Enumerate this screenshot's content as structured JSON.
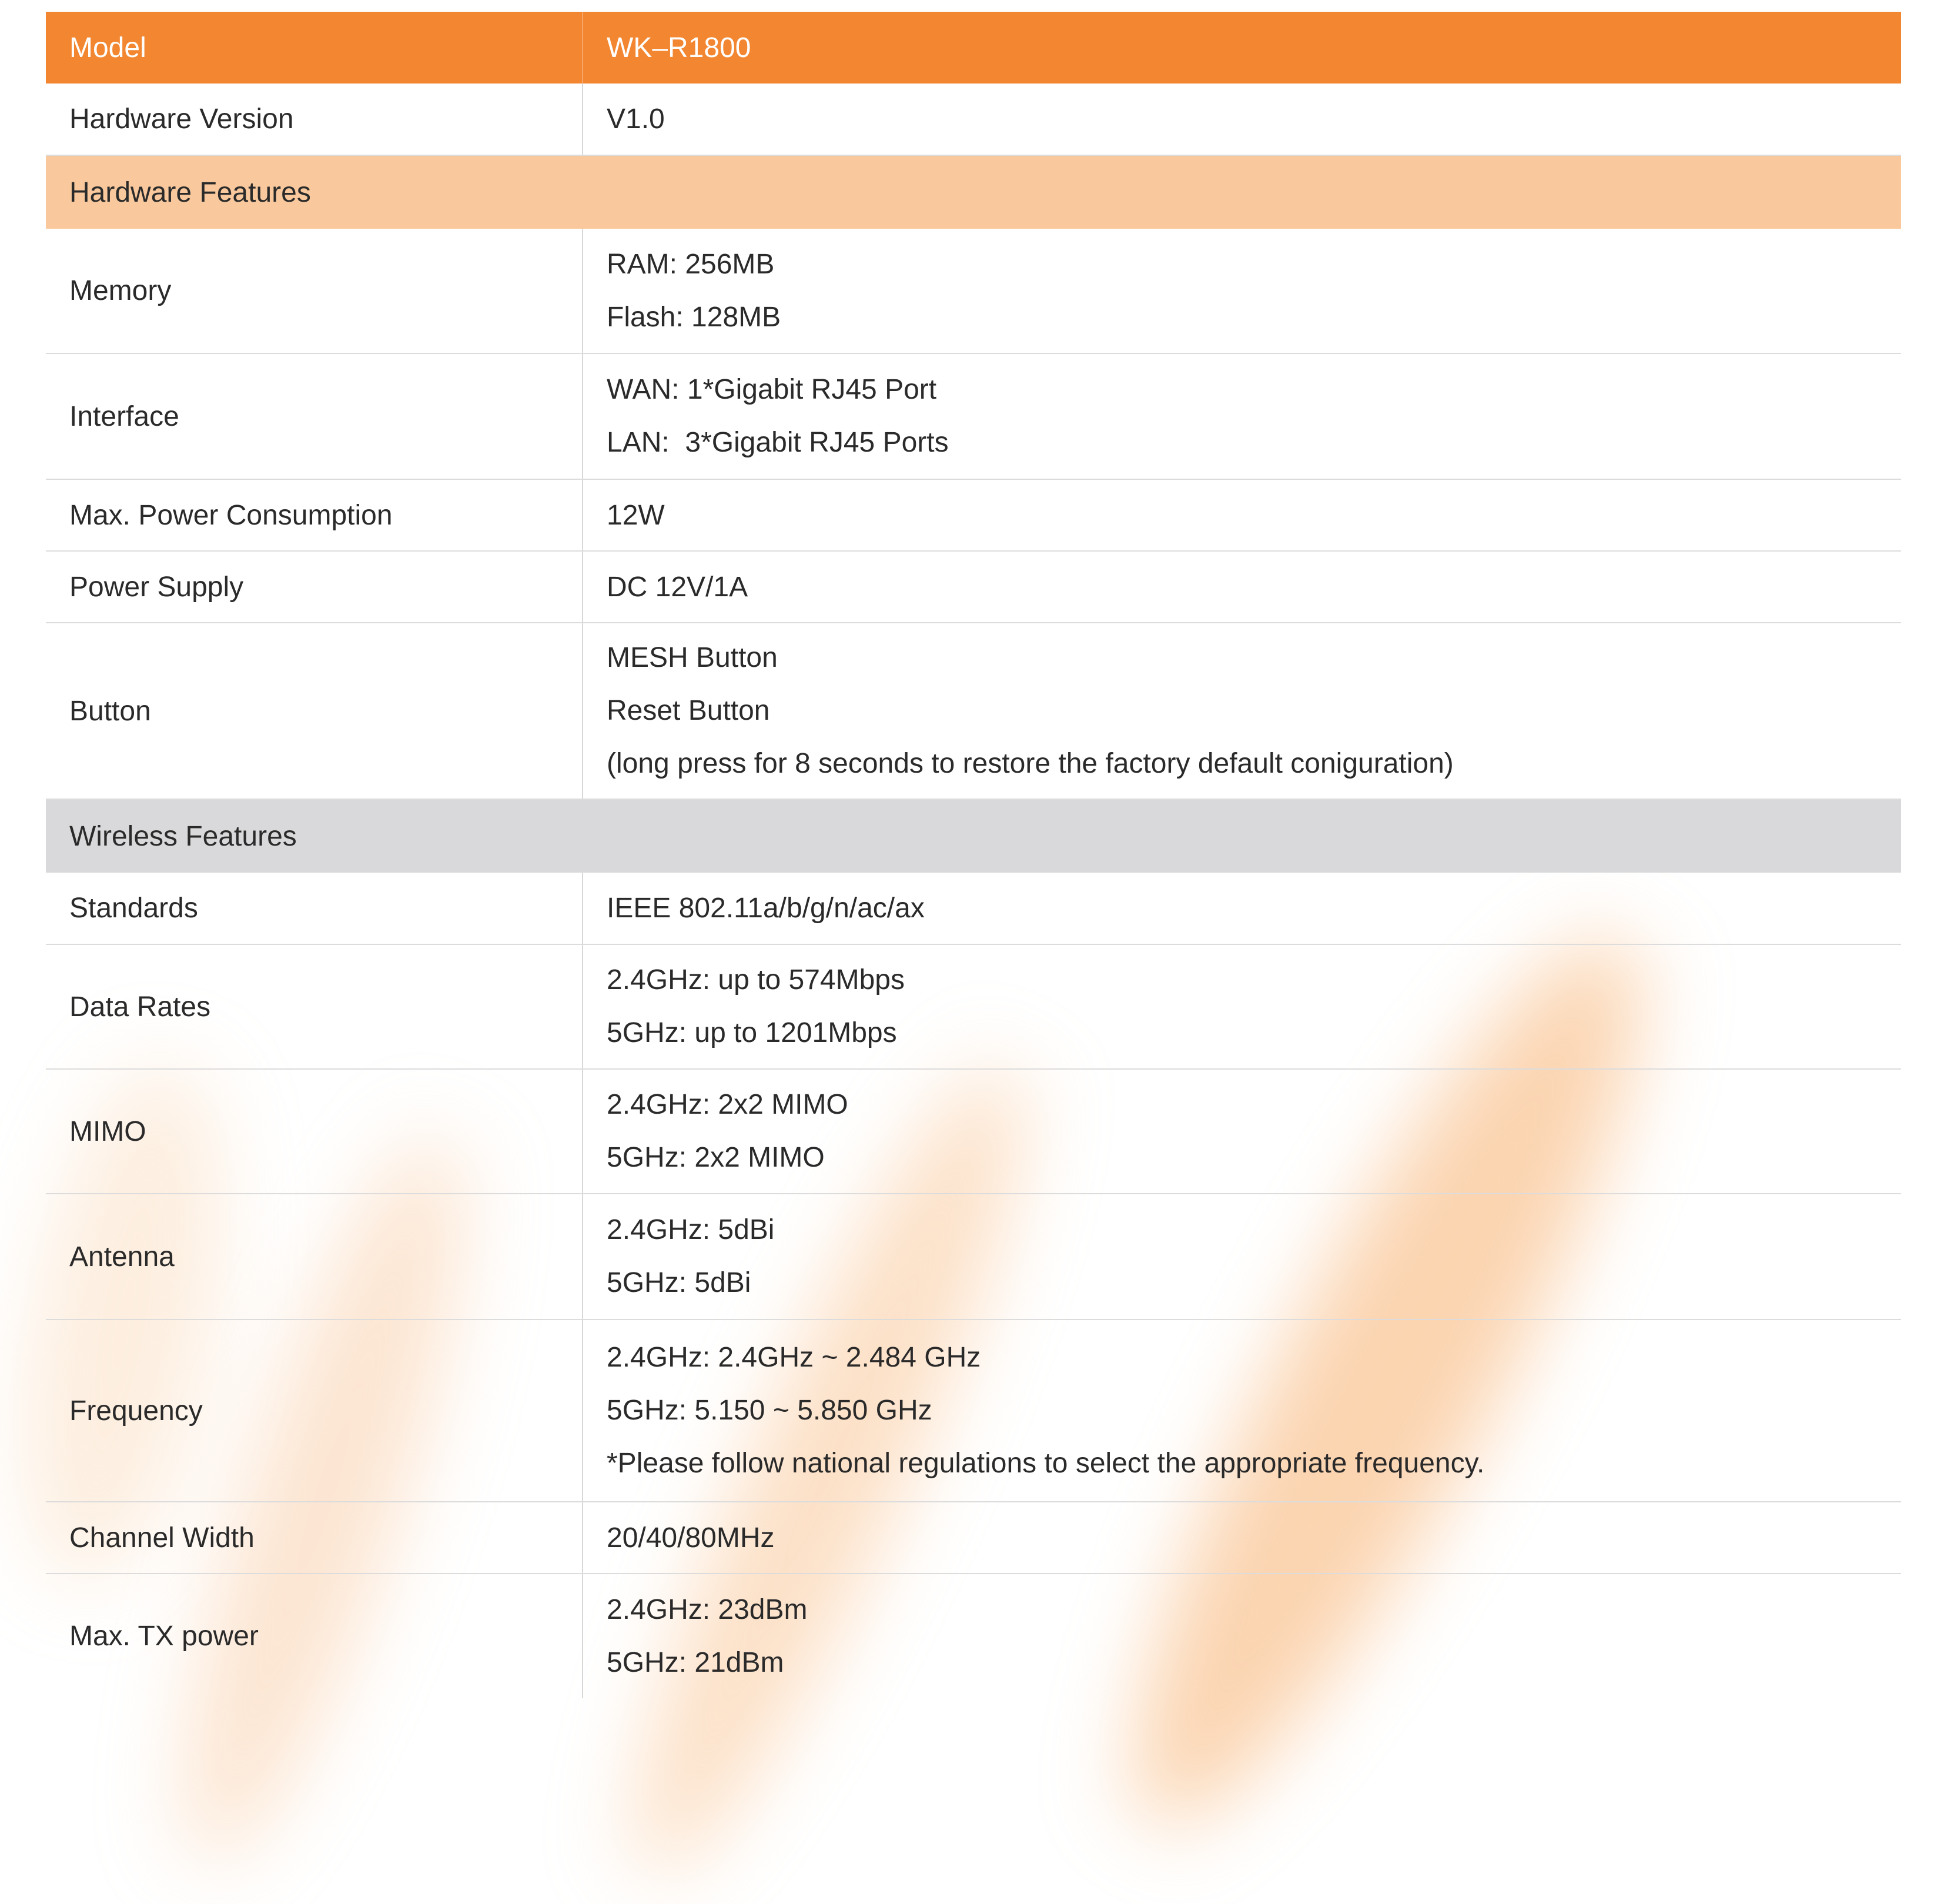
{
  "header": {
    "label": "Model",
    "value": "WK–R1800"
  },
  "hardware_version": {
    "label": "Hardware Version",
    "value": "V1.0"
  },
  "sections": {
    "hardware": "Hardware Features",
    "wireless": "Wireless Features"
  },
  "rows": {
    "memory": {
      "label": "Memory",
      "lines": [
        "RAM: 256MB",
        "Flash: 128MB"
      ]
    },
    "interface": {
      "label": "Interface",
      "lines": [
        "WAN: 1*Gigabit RJ45 Port",
        "LAN:  3*Gigabit RJ45 Ports"
      ]
    },
    "power_consumption": {
      "label": "Max. Power Consumption",
      "lines": [
        "12W"
      ]
    },
    "power_supply": {
      "label": "Power Supply",
      "lines": [
        "DC 12V/1A"
      ]
    },
    "button": {
      "label": "Button",
      "lines": [
        "MESH Button",
        "Reset Button",
        "(long press for 8 seconds to restore the factory default coniguration)"
      ]
    },
    "standards": {
      "label": "Standards",
      "lines": [
        "IEEE 802.11a/b/g/n/ac/ax"
      ]
    },
    "data_rates": {
      "label": "Data Rates",
      "lines": [
        "2.4GHz: up to 574Mbps",
        "5GHz: up to 1201Mbps"
      ]
    },
    "mimo": {
      "label": "MIMO",
      "lines": [
        "2.4GHz: 2x2 MIMO",
        "5GHz: 2x2 MIMO"
      ]
    },
    "antenna": {
      "label": "Antenna",
      "lines": [
        "2.4GHz: 5dBi",
        "5GHz: 5dBi"
      ]
    },
    "frequency": {
      "label": "Frequency",
      "lines": [
        "2.4GHz: 2.4GHz ~ 2.484 GHz",
        "5GHz: 5.150 ~ 5.850 GHz",
        "*Please follow national regulations to select the appropriate frequency."
      ]
    },
    "channel_width": {
      "label": "Channel Width",
      "lines": [
        "20/40/80MHz"
      ]
    },
    "tx_power": {
      "label": "Max. TX power",
      "lines": [
        "2.4GHz: 23dBm",
        "5GHz: 21dBm"
      ]
    }
  },
  "colors": {
    "header_bg": "#f28631",
    "hardware_section_bg": "#f9c99d",
    "wireless_section_bg": "#d9d9db"
  }
}
